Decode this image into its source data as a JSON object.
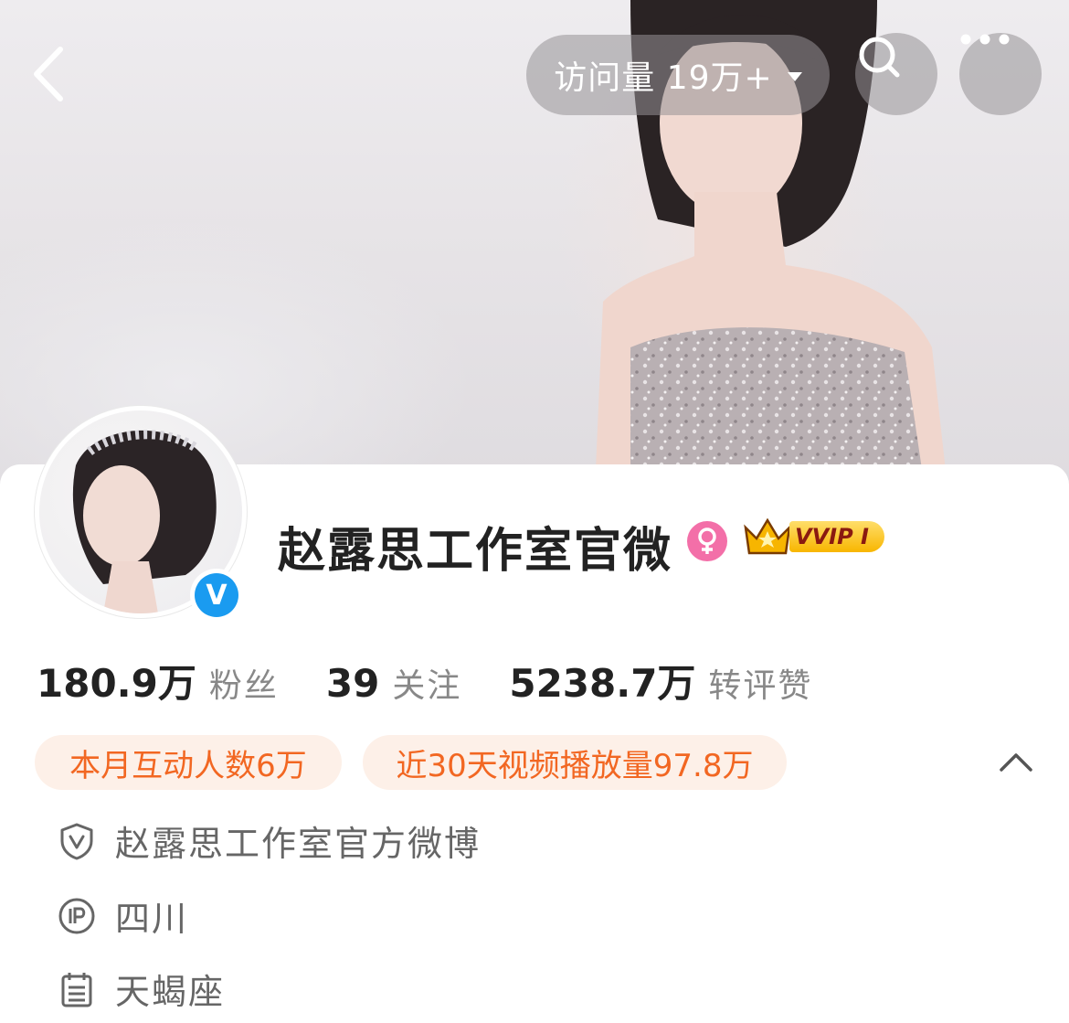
{
  "header": {
    "visits_label": "访问量 19万+",
    "back_icon": "chevron-left-icon",
    "search_icon": "search-icon",
    "more_icon": "more-dots-icon"
  },
  "profile": {
    "name": "赵露思工作室官微",
    "verified_badge": "V",
    "gender_icon": "female-icon",
    "vip_badge": "VVIP I"
  },
  "stats": [
    {
      "value": "180.9万",
      "label": "粉丝"
    },
    {
      "value": "39",
      "label": "关注"
    },
    {
      "value": "5238.7万",
      "label": "转评赞"
    }
  ],
  "tags": [
    "本月互动人数6万",
    "近30天视频播放量97.8万"
  ],
  "info": [
    {
      "icon": "verified-shield-icon",
      "text": "赵露思工作室官方微博"
    },
    {
      "icon": "ip-location-icon",
      "text": "四川"
    },
    {
      "icon": "calendar-icon",
      "text": "天蝎座"
    }
  ],
  "colors": {
    "accent_orange": "#f26722",
    "tag_bg": "#fdf0e8",
    "verified_blue": "#1a9bf0",
    "female_pink": "#f36fa8"
  }
}
